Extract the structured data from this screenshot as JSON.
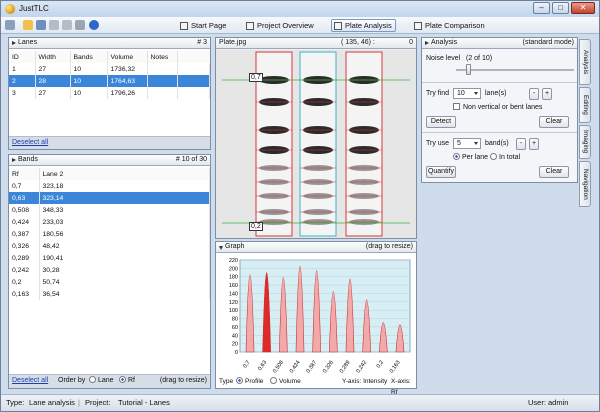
{
  "window": {
    "title": "JustTLC",
    "controls": {
      "minimize": "–",
      "maximize": "□",
      "close": "✕"
    }
  },
  "nav": {
    "start": "Start Page",
    "overview": "Project Overview",
    "analysis": "Plate Analysis",
    "comparison": "Plate Comparison"
  },
  "lanes": {
    "title": "Lanes",
    "count": "# 3",
    "columns": [
      "ID",
      "Width",
      "Bands",
      "Volume",
      "Notes"
    ],
    "rows": [
      [
        "1",
        "27",
        "10",
        "1736,32",
        ""
      ],
      [
        "2",
        "28",
        "10",
        "1764,63",
        ""
      ],
      [
        "3",
        "27",
        "10",
        "1796,26",
        ""
      ]
    ],
    "deselect": "Deselect all"
  },
  "bands": {
    "title": "Bands",
    "count": "# 10 of 30",
    "columns": [
      "Rf",
      "Lane 2"
    ],
    "rows": [
      [
        "0,7",
        "323,18"
      ],
      [
        "0,63",
        "323,14"
      ],
      [
        "0,508",
        "348,33"
      ],
      [
        "0,424",
        "233,03"
      ],
      [
        "0,387",
        "180,56"
      ],
      [
        "0,326",
        "48,42"
      ],
      [
        "0,289",
        "190,41"
      ],
      [
        "0,242",
        "30,28"
      ],
      [
        "0,2",
        "50,74"
      ],
      [
        "0,163",
        "36,54"
      ]
    ],
    "deselect": "Deselect all",
    "order_by": "Order by",
    "opt_lane": "Lane",
    "opt_rf": "Rf",
    "resize": "(drag to resize)"
  },
  "plate": {
    "title": "Plate.jpg",
    "coords": "( 135, 46) :",
    "zero": "0",
    "label_top": "0,7",
    "label_bottom": "0,2"
  },
  "graph": {
    "title": "Graph",
    "resize": "(drag to resize)",
    "type_label": "Type",
    "opt_profile": "Profile",
    "opt_volume": "Volume",
    "y_axis": "Y-axis: Intensity",
    "x_axis": "X-axis: Rf",
    "y_ticks": [
      "220",
      "200",
      "180",
      "160",
      "140",
      "120",
      "100",
      "80",
      "60",
      "40",
      "20",
      "0"
    ],
    "x_ticks": [
      "0,7",
      "0,63",
      "0,508",
      "0,424",
      "0,387",
      "0,326",
      "0,289",
      "0,242",
      "0,2",
      "0,163"
    ]
  },
  "chart_data": {
    "type": "area",
    "xlabel": "X-axis: Rf",
    "ylabel": "Y-axis: Intensity",
    "ylim": [
      0,
      220
    ],
    "x": [
      "0,7",
      "0,63",
      "0,508",
      "0,424",
      "0,387",
      "0,326",
      "0,289",
      "0,242",
      "0,2",
      "0,163"
    ],
    "values": [
      185,
      190,
      178,
      205,
      195,
      145,
      175,
      125,
      70,
      65
    ],
    "highlight_index": 1
  },
  "analysis": {
    "title": "Analysis",
    "mode": "(standard mode)",
    "noise_label": "Noise level",
    "noise_value": "(2 of 10)",
    "try_find": "Try find",
    "lanes_value": "10",
    "lanes_unit": "lane(s)",
    "non_vertical": "Non vertical or bent lanes",
    "detect": "Detect",
    "clear": "Clear",
    "try_use": "Try use",
    "bands_value": "5",
    "bands_unit": "band(s)",
    "per_lane": "Per lane",
    "in_total": "In total",
    "quantify": "Quantify",
    "clear2": "Clear",
    "minus": "-",
    "plus": "+"
  },
  "side_tabs": [
    "Analysis",
    "Editing",
    "Imaging",
    "Navigation"
  ],
  "status": {
    "type_label": "Type:",
    "type_value": "Lane analysis",
    "project_label": "Project:",
    "project_value": "Tutorial - Lanes",
    "user_label": "User:",
    "user_value": "admin"
  }
}
